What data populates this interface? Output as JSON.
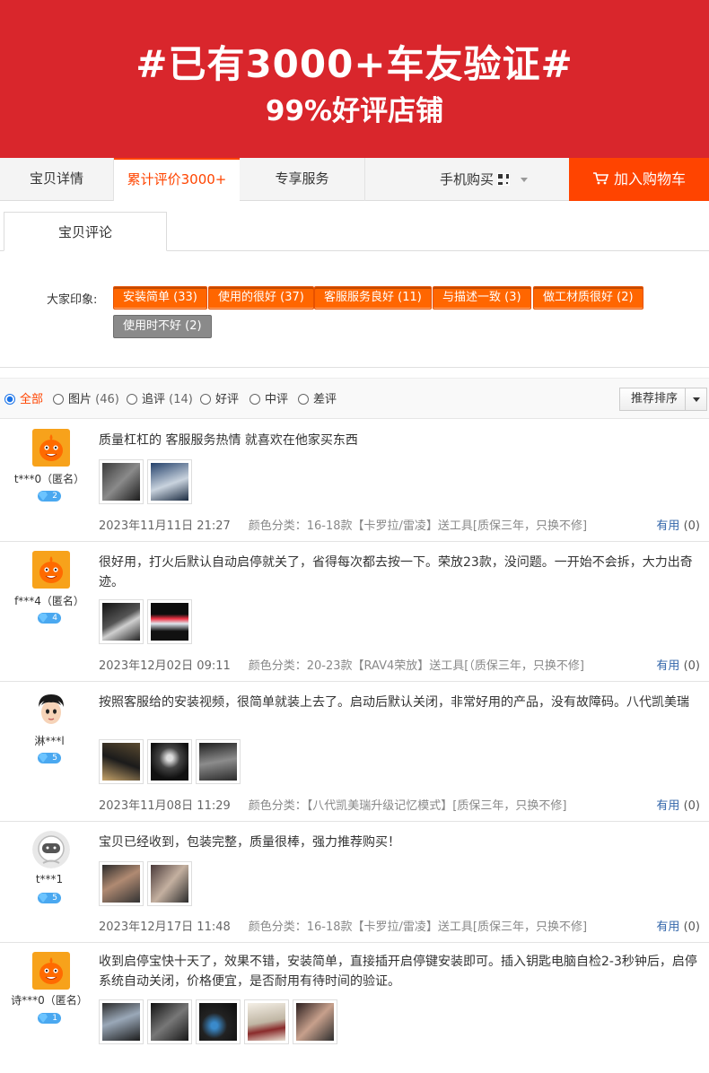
{
  "banner": {
    "title": "#已有3000+车友验证#",
    "subtitle": "99%好评店铺"
  },
  "tabs": [
    {
      "label": "宝贝详情"
    },
    {
      "label": "累计评价3000+"
    },
    {
      "label": "专享服务"
    }
  ],
  "mobile_buy": {
    "label": "手机购买"
  },
  "cart": {
    "label": "加入购物车"
  },
  "subtab": {
    "label": "宝贝评论"
  },
  "impressions": {
    "label": "大家印象:",
    "tags": [
      {
        "text": "安装简单 (33)",
        "sentiment": "positive"
      },
      {
        "text": "使用的很好 (37)",
        "sentiment": "positive"
      },
      {
        "text": "客服服务良好 (11)",
        "sentiment": "positive"
      },
      {
        "text": "与描述一致 (3)",
        "sentiment": "positive"
      },
      {
        "text": "做工材质很好 (2)",
        "sentiment": "positive"
      },
      {
        "text": "使用时不好 (2)",
        "sentiment": "negative"
      }
    ]
  },
  "filters": {
    "options": [
      {
        "label": "全部",
        "count": ""
      },
      {
        "label": "图片",
        "count": "(46)"
      },
      {
        "label": "追评",
        "count": "(14)"
      },
      {
        "label": "好评",
        "count": ""
      },
      {
        "label": "中评",
        "count": ""
      },
      {
        "label": "差评",
        "count": ""
      }
    ],
    "selected": "全部",
    "sort": "推荐排序"
  },
  "useful_label": "有用",
  "reviews": [
    {
      "user": "t***0（匿名）",
      "level": "2",
      "avatar": "taobao-mascot",
      "text": "质量杠杠的 客服服务热情 就喜欢在他家买东西",
      "date": "2023年11月11日 21:27",
      "spec": "颜色分类：16-18款【卡罗拉/雷凌】送工具[质保三年，只换不修]",
      "useful_count": "(0)"
    },
    {
      "user": "f***4（匿名）",
      "level": "4",
      "avatar": "taobao-mascot",
      "text": "很好用，打火后默认自动启停就关了，省得每次都去按一下。荣放23款，没问题。一开始不会拆，大力出奇迹。",
      "date": "2023年12月02日 09:11",
      "spec": "颜色分类：20-23款【RAV4荣放】送工具[（质保三年，只换不修]",
      "useful_count": "(0)"
    },
    {
      "user": "淋***l",
      "level": "5",
      "avatar": "cartoon-face",
      "text": "按照客服给的安装视频，很简单就装上去了。启动后默认关闭，非常好用的产品，没有故障码。八代凯美瑞",
      "date": "2023年11月08日 11:29",
      "spec": "颜色分类：【八代凯美瑞升级记忆模式】[质保三年，只换不修]",
      "useful_count": "(0)"
    },
    {
      "user": "t***1",
      "level": "5",
      "avatar": "astronaut",
      "text": "宝贝已经收到，包装完整，质量很棒，强力推荐购买！",
      "date": "2023年12月17日 11:48",
      "spec": "颜色分类：16-18款【卡罗拉/雷凌】送工具[质保三年，只换不修]",
      "useful_count": "(0)"
    },
    {
      "user": "诗***0（匿名）",
      "level": "1",
      "avatar": "taobao-mascot",
      "text": "收到启停宝快十天了，效果不错，安装简单，直接插开启停键安装即可。插入钥匙电脑自检2-3秒钟后，启停系统自动关闭，价格便宜，是否耐用有待时间的验证。",
      "date": "",
      "spec": "",
      "useful_count": ""
    }
  ],
  "colors": {
    "banner": "#d9262c",
    "accent": "#ff4400",
    "tag": "#ff6600",
    "tag_negative": "#8a8a8a",
    "link": "#3366aa"
  }
}
